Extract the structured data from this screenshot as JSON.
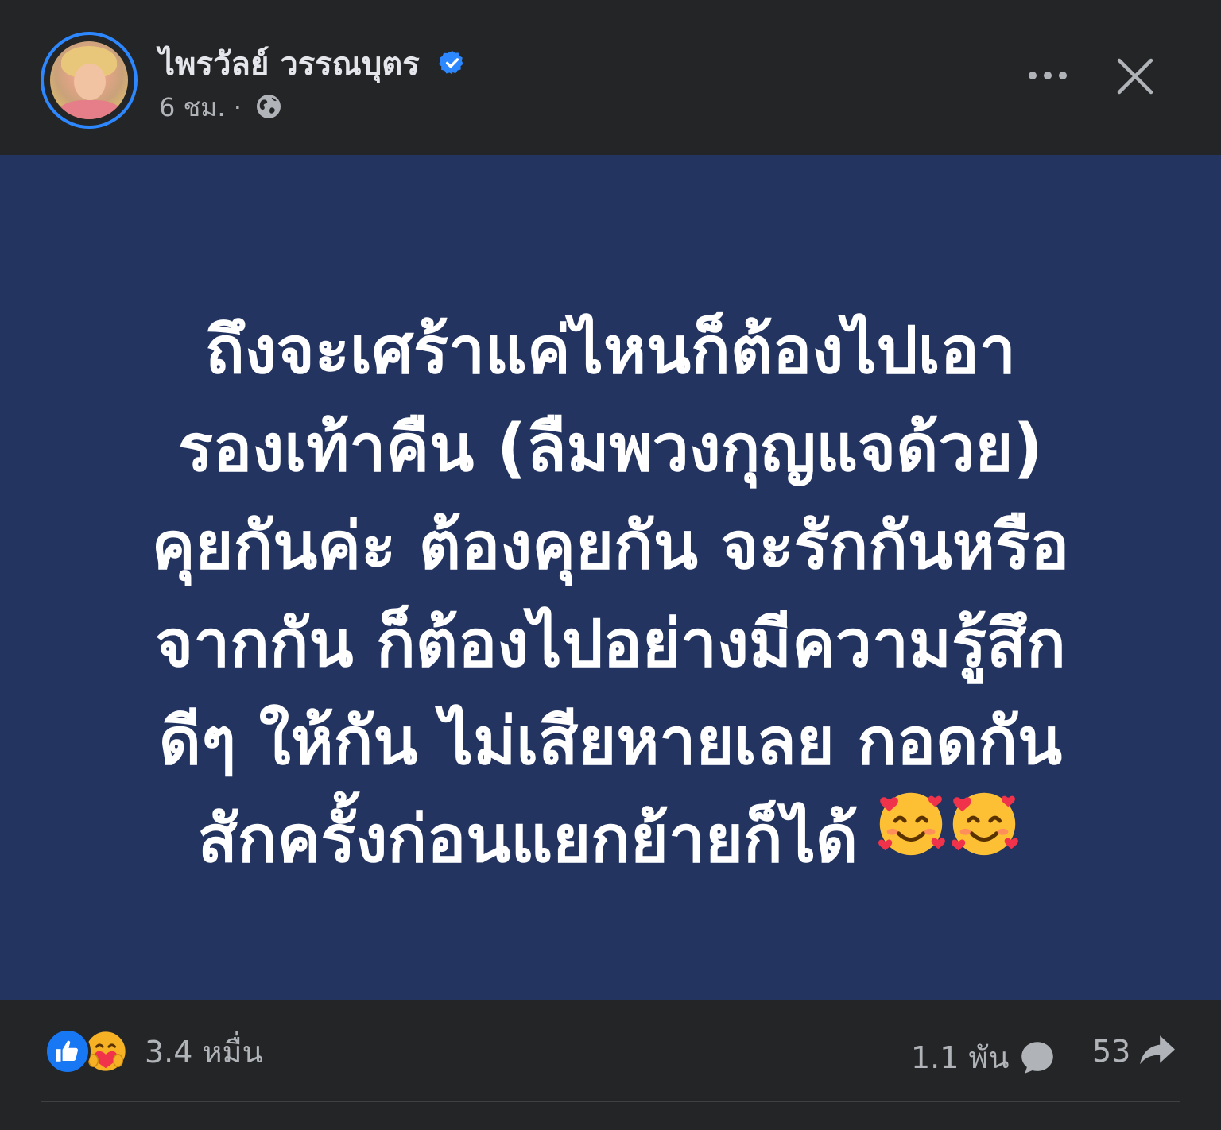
{
  "post": {
    "author_name": "ไพรวัลย์ วรรณบุตร",
    "verified_icon": "verified-badge-icon",
    "timestamp": "6 ชม.",
    "separator": "·",
    "privacy_icon": "globe-icon",
    "content_lines": [
      "ถึงจะเศร้าแค่ไหนก็ต้องไปเอา",
      "รองเท้าคืน (ลืมพวงกุญแจด้วย)",
      "คุยกันค่ะ ต้องคุยกัน จะรักกันหรือ",
      "จากกัน ก็ต้องไปอย่างมีความรู้สึก",
      "ดีๆ ให้กัน ไม่เสียหายเลย กอดกัน",
      "สักครั้งก่อนแยกย้ายก็ได้"
    ],
    "content_emojis": [
      "smiling-face-with-hearts",
      "smiling-face-with-hearts"
    ],
    "background_color": "#233460"
  },
  "footer": {
    "reaction_icons": [
      "like-icon",
      "care-icon"
    ],
    "reaction_count": "3.4 หมื่น",
    "comment_count": "1.1 พัน",
    "share_count": "53"
  },
  "colors": {
    "accent": "#1877f2",
    "verified": "#2d88ff",
    "surface": "#242526",
    "secondary_text": "#b0b3b8"
  }
}
